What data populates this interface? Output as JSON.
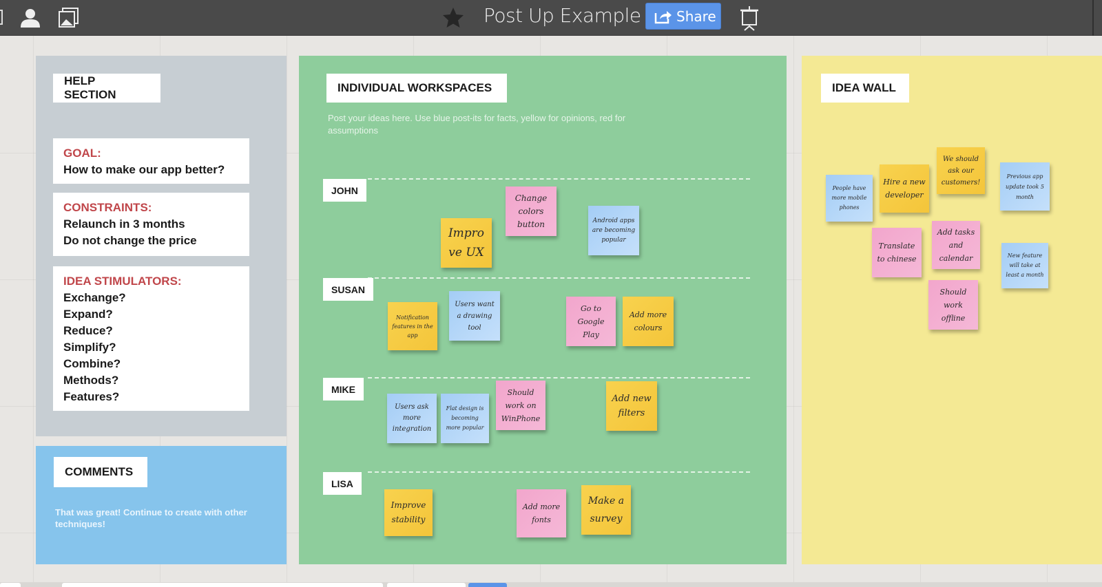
{
  "app": {
    "title": "Post Up Example",
    "share_label": "Share",
    "icons": [
      "user-icon",
      "gallery-icon",
      "star-icon",
      "share-icon",
      "presentation-icon"
    ]
  },
  "help": {
    "title": "HELP SECTION",
    "goal_heading": "GOAL:",
    "goal_text": "How to make our app better?",
    "constraints_heading": "CONSTRAINTS:",
    "constraints": [
      "Relaunch in 3 months",
      "Do not change the price"
    ],
    "stimulators_heading": "IDEA STIMULATORS:",
    "stimulators": [
      "Exchange?",
      "Expand?",
      "Reduce?",
      "Simplify?",
      "Combine?",
      "Methods?",
      "Features?"
    ]
  },
  "comments": {
    "title": "COMMENTS",
    "text": "That was great! Continue to create with other techniques!"
  },
  "workspaces": {
    "title": "INDIVIDUAL WORKSPACES",
    "hint": "Post your ideas here. Use blue post-its for facts, yellow for opinions, red for assumptions",
    "lanes": [
      {
        "name": "JOHN",
        "notes": [
          {
            "text": "Impro ve UX",
            "color": "yellow"
          },
          {
            "text": "Change colors button",
            "color": "pink"
          },
          {
            "text": "Android apps are becoming popular",
            "color": "blue"
          }
        ]
      },
      {
        "name": "SUSAN",
        "notes": [
          {
            "text": "Notification features in the app",
            "color": "yellow"
          },
          {
            "text": "Users want a drawing tool",
            "color": "blue"
          },
          {
            "text": "Go to Google Play",
            "color": "pink"
          },
          {
            "text": "Add more colours",
            "color": "yellow"
          }
        ]
      },
      {
        "name": "MIKE",
        "notes": [
          {
            "text": "Users ask more integration",
            "color": "blue"
          },
          {
            "text": "Flat design is becoming more popular",
            "color": "blue"
          },
          {
            "text": "Should work on WinPhone",
            "color": "pink"
          },
          {
            "text": "Add new filters",
            "color": "yellow"
          }
        ]
      },
      {
        "name": "LISA",
        "notes": [
          {
            "text": "Improve stability",
            "color": "yellow"
          },
          {
            "text": "Add more fonts",
            "color": "pink"
          },
          {
            "text": "Make a survey",
            "color": "yellow"
          }
        ]
      }
    ]
  },
  "ideawall": {
    "title": "IDEA WALL",
    "notes": [
      {
        "text": "People have more mobile phones",
        "color": "blue"
      },
      {
        "text": "Hire a new developer",
        "color": "yellow"
      },
      {
        "text": "We should ask our customers!",
        "color": "yellow"
      },
      {
        "text": "Previous app update took 5 month",
        "color": "blue"
      },
      {
        "text": "Translate to chinese",
        "color": "pink"
      },
      {
        "text": "Add tasks and calendar",
        "color": "pink"
      },
      {
        "text": "New feature will take at least a month",
        "color": "blue"
      },
      {
        "text": "Should work offline",
        "color": "pink"
      }
    ]
  },
  "colors": {
    "topbar": "#4a4a4a",
    "share": "#5b94e8",
    "help_panel": "#c7ced3",
    "comments_panel": "#86c4ec",
    "workspaces_panel": "#8ecd9c",
    "ideawall_panel": "#f4e994",
    "heading_red": "#c0464a",
    "note_yellow": "#f6ca42",
    "note_pink": "#f3aed0",
    "note_blue": "#b3d6f8"
  }
}
